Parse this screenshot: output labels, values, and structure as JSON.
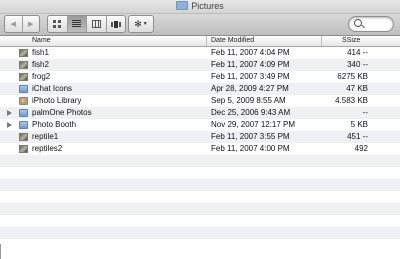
{
  "window": {
    "title": "Pictures"
  },
  "search": {
    "value": "",
    "placeholder": ""
  },
  "columns": {
    "name": "Name",
    "date": "Date Modified",
    "size": "Size",
    "sort_indicator": "S"
  },
  "files": [
    {
      "name": "fish1",
      "date": "Feb 11, 2007 4:04 PM",
      "size": "414  --",
      "icon": "image-file-icon",
      "expandable": false
    },
    {
      "name": "fish2",
      "date": "Feb 11, 2007 4:09 PM",
      "size": "340  --",
      "icon": "image-file-icon",
      "expandable": false
    },
    {
      "name": "frog2",
      "date": "Feb 11, 2007 3:49 PM",
      "size": "6275 KB",
      "icon": "image-file-icon",
      "expandable": false
    },
    {
      "name": "iChat Icons",
      "date": "Apr 28, 2009 4:27 PM",
      "size": "47 KB",
      "icon": "folder-icon",
      "expandable": false
    },
    {
      "name": "iPhoto Library",
      "date": "Sep 5, 2009 8:55 AM",
      "size": "4.583 KB",
      "icon": "iphoto-library-icon",
      "expandable": false
    },
    {
      "name": "palmOne Photos",
      "date": "Dec 25, 2006 9:43 AM",
      "size": "--",
      "icon": "folder-icon",
      "expandable": true
    },
    {
      "name": "Photo Booth",
      "date": "Nov 29, 2007 12:17 PM",
      "size": "5 KB",
      "icon": "folder-icon",
      "expandable": true
    },
    {
      "name": "reptile1",
      "date": "Feb 11, 2007 3:55 PM",
      "size": "451  --",
      "icon": "image-file-icon",
      "expandable": false
    },
    {
      "name": "reptiles2",
      "date": "Feb 11, 2007 4:00 PM",
      "size": "492",
      "icon": "image-file-icon",
      "expandable": false
    }
  ],
  "empty_rows": 8,
  "icons": {
    "back": "chevron-left-icon",
    "forward": "chevron-right-icon",
    "views": [
      "icon-view-icon",
      "list-view-icon",
      "column-view-icon",
      "cover-flow-icon"
    ],
    "action": "gear-icon",
    "search": "search-icon"
  },
  "colors": {
    "stripe": "#eef0f3",
    "folder": "#8fb2dc"
  }
}
